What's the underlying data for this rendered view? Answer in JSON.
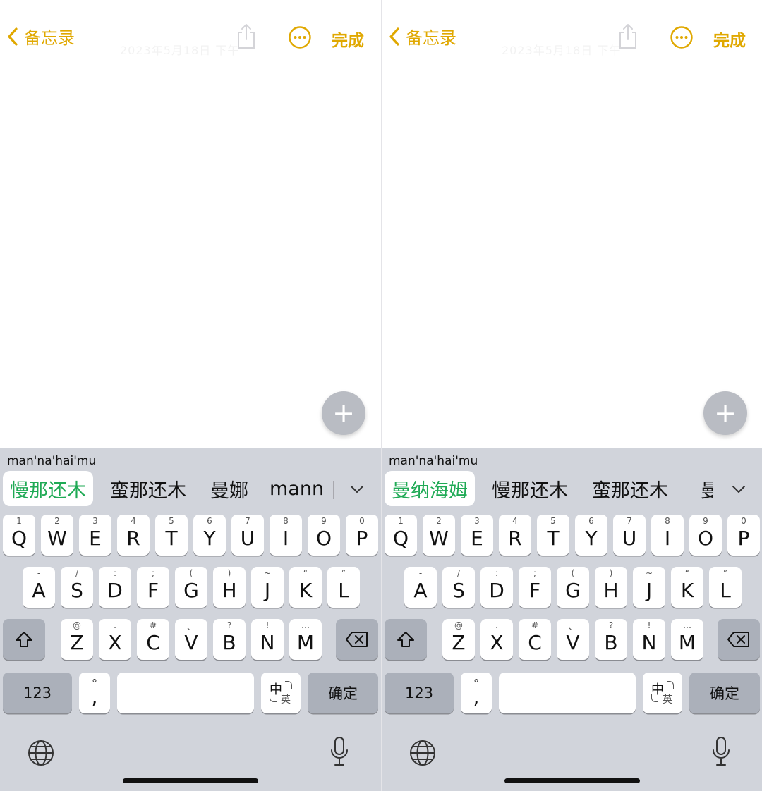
{
  "colors": {
    "accent": "#e0a800",
    "selected_candidate": "#1faa55",
    "keyboard_bg": "#d1d4db"
  },
  "panels": [
    {
      "nav": {
        "back_label": "备忘录",
        "done_label": "完成",
        "faint_title": "2023年5月18日 下午"
      },
      "keyboard": {
        "pinyin": "man'na'hai'mu",
        "candidates": [
          "慢那还木",
          "蛮那还木",
          "曼娜",
          "mann"
        ],
        "selected_index": 0
      }
    },
    {
      "nav": {
        "back_label": "备忘录",
        "done_label": "完成",
        "faint_title": "2023年5月18日 下午"
      },
      "keyboard": {
        "pinyin": "man'na'hai'mu",
        "candidates": [
          "曼纳海姆",
          "慢那还木",
          "蛮那还木",
          "曼"
        ],
        "selected_index": 0
      }
    }
  ],
  "keys": {
    "row1": [
      {
        "l": "Q",
        "h": "1"
      },
      {
        "l": "W",
        "h": "2"
      },
      {
        "l": "E",
        "h": "3"
      },
      {
        "l": "R",
        "h": "4"
      },
      {
        "l": "T",
        "h": "5"
      },
      {
        "l": "Y",
        "h": "6"
      },
      {
        "l": "U",
        "h": "7"
      },
      {
        "l": "I",
        "h": "8"
      },
      {
        "l": "O",
        "h": "9"
      },
      {
        "l": "P",
        "h": "0"
      }
    ],
    "row2": [
      {
        "l": "A",
        "h": "-"
      },
      {
        "l": "S",
        "h": "/"
      },
      {
        "l": "D",
        "h": ":"
      },
      {
        "l": "F",
        "h": ";"
      },
      {
        "l": "G",
        "h": "("
      },
      {
        "l": "H",
        "h": ")"
      },
      {
        "l": "J",
        "h": "~"
      },
      {
        "l": "K",
        "h": "“"
      },
      {
        "l": "L",
        "h": "”"
      }
    ],
    "row3": [
      {
        "l": "Z",
        "h": "@"
      },
      {
        "l": "X",
        "h": "."
      },
      {
        "l": "C",
        "h": "#"
      },
      {
        "l": "V",
        "h": "、"
      },
      {
        "l": "B",
        "h": "?"
      },
      {
        "l": "N",
        "h": "!"
      },
      {
        "l": "M",
        "h": "…"
      }
    ],
    "numbers_label": "123",
    "punct_top": "°",
    "punct_main": ",",
    "zh_label": "中",
    "en_label": "英",
    "confirm_label": "确定"
  }
}
